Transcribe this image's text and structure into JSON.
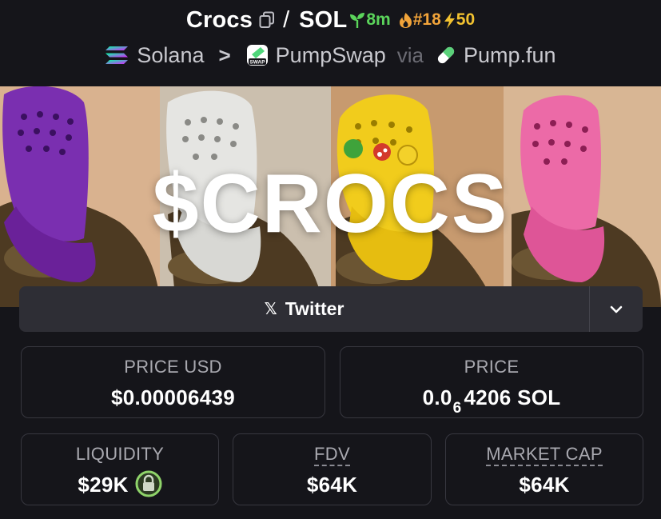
{
  "header": {
    "token_symbol": "Crocs",
    "slash": "/",
    "quote_symbol": "SOL",
    "age": "8m",
    "rank": "#18",
    "boosts": "50"
  },
  "breadcrumb": {
    "chain": "Solana",
    "separator": ">",
    "dex": "PumpSwap",
    "swap_badge": "SWAP",
    "via": "via",
    "launchpad": "Pump.fun"
  },
  "banner": {
    "text": "$CROCS"
  },
  "social": {
    "x_glyph": "𝕏",
    "twitter_label": "Twitter"
  },
  "stats": {
    "price_usd": {
      "label": "PRICE USD",
      "value": "$0.00006439"
    },
    "price": {
      "label": "PRICE",
      "value_prefix": "0.0",
      "zero_count": "6",
      "value_digits": "4206",
      "value_unit": "SOL"
    },
    "liquidity": {
      "label": "LIQUIDITY",
      "value": "$29K"
    },
    "fdv": {
      "label": "FDV",
      "value": "$64K"
    },
    "market_cap": {
      "label": "MARKET CAP",
      "value": "$64K"
    }
  },
  "colors": {
    "background": "#15151a",
    "card_border": "#37373f",
    "age_green": "#5bd45b",
    "rank_orange": "#f2a43a",
    "boost_yellow": "#f2c230",
    "lock_green": "#8fd46a"
  },
  "icons": [
    "copy-icon",
    "seedling-icon",
    "flame-icon",
    "bolt-icon",
    "solana-icon",
    "pumpswap-icon",
    "pill-icon",
    "x-icon",
    "chevron-down-icon",
    "lock-icon"
  ]
}
